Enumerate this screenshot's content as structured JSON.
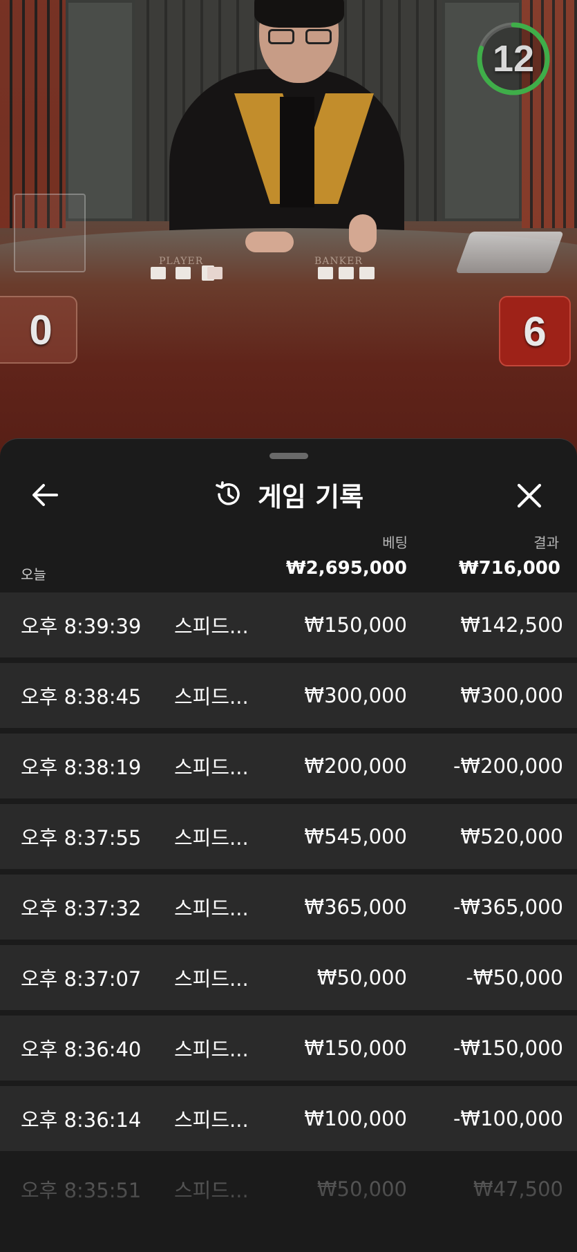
{
  "video": {
    "timer": "12",
    "timer_progress": 0.8,
    "table_labels": {
      "player": "PLAYER",
      "banker": "BANKER"
    },
    "scores": {
      "player": "0",
      "banker": "6"
    }
  },
  "sheet": {
    "title": "게임 기록",
    "icons": {
      "back": "arrow-left-icon",
      "history": "history-clock-icon",
      "close": "close-icon"
    },
    "columns": {
      "bet": "베팅",
      "result": "결과"
    },
    "summary": {
      "label": "오늘",
      "bet_total": "₩2,695,000",
      "result_total": "₩716,000"
    },
    "rows": [
      {
        "time": "오후 8:39:39",
        "game": "스피드...",
        "bet": "₩150,000",
        "result": "₩142,500"
      },
      {
        "time": "오후 8:38:45",
        "game": "스피드...",
        "bet": "₩300,000",
        "result": "₩300,000"
      },
      {
        "time": "오후 8:38:19",
        "game": "스피드...",
        "bet": "₩200,000",
        "result": "-₩200,000"
      },
      {
        "time": "오후 8:37:55",
        "game": "스피드...",
        "bet": "₩545,000",
        "result": "₩520,000"
      },
      {
        "time": "오후 8:37:32",
        "game": "스피드...",
        "bet": "₩365,000",
        "result": "-₩365,000"
      },
      {
        "time": "오후 8:37:07",
        "game": "스피드...",
        "bet": "₩50,000",
        "result": "-₩50,000"
      },
      {
        "time": "오후 8:36:40",
        "game": "스피드...",
        "bet": "₩150,000",
        "result": "-₩150,000"
      },
      {
        "time": "오후 8:36:14",
        "game": "스피드...",
        "bet": "₩100,000",
        "result": "-₩100,000"
      },
      {
        "time": "오후 8:35:51",
        "game": "스피드...",
        "bet": "₩50,000",
        "result": "₩47,500"
      }
    ]
  },
  "colors": {
    "timer_ring": "#3fae49",
    "banker_score_bg": "#9e2218",
    "sheet_bg": "#1b1b1b",
    "row_bg": "#2a2a2a"
  }
}
